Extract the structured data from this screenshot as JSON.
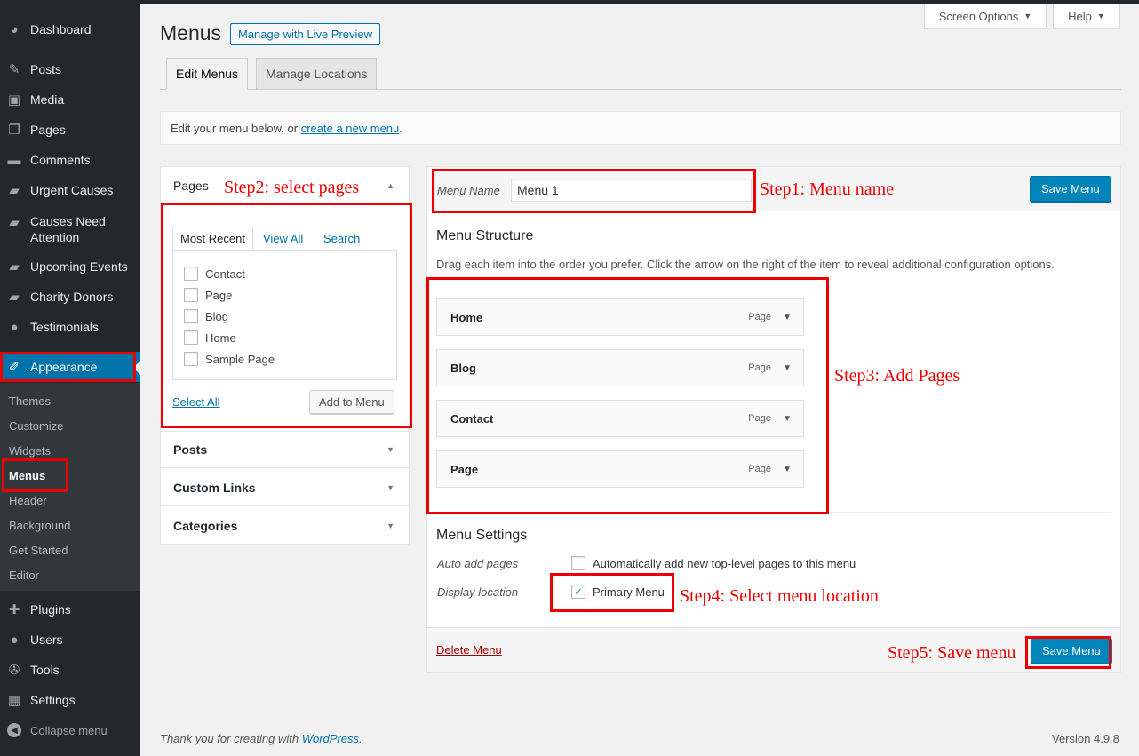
{
  "sidebar": {
    "items": [
      {
        "label": "Dashboard",
        "icon": "dashboard-icon"
      },
      {
        "label": "Posts",
        "icon": "pin-icon"
      },
      {
        "label": "Media",
        "icon": "media-icon"
      },
      {
        "label": "Pages",
        "icon": "pages-icon"
      },
      {
        "label": "Comments",
        "icon": "comment-icon"
      },
      {
        "label": "Urgent Causes",
        "icon": "folder-icon"
      },
      {
        "label": "Causes Need Attention",
        "icon": "folder-icon"
      },
      {
        "label": "Upcoming Events",
        "icon": "folder-icon"
      },
      {
        "label": "Charity Donors",
        "icon": "folder-icon"
      },
      {
        "label": "Testimonials",
        "icon": "user-icon"
      },
      {
        "label": "Appearance",
        "icon": "brush-icon"
      },
      {
        "label": "Plugins",
        "icon": "plugin-icon"
      },
      {
        "label": "Users",
        "icon": "user-icon"
      },
      {
        "label": "Tools",
        "icon": "wrench-icon"
      },
      {
        "label": "Settings",
        "icon": "settings-icon"
      }
    ],
    "submenu": [
      "Themes",
      "Customize",
      "Widgets",
      "Menus",
      "Header",
      "Background",
      "Get Started",
      "Editor"
    ],
    "collapse_label": "Collapse menu"
  },
  "header": {
    "screen_options": "Screen Options",
    "help": "Help",
    "title": "Menus",
    "live_preview": "Manage with Live Preview"
  },
  "tabs": [
    "Edit Menus",
    "Manage Locations"
  ],
  "notice": {
    "prefix": "Edit your menu below, or ",
    "link": "create a new menu",
    "suffix": "."
  },
  "accordion": {
    "pages_title": "Pages",
    "page_tabs": [
      "Most Recent",
      "View All",
      "Search"
    ],
    "pages": [
      "Contact",
      "Page",
      "Blog",
      "Home",
      "Sample Page"
    ],
    "select_all": "Select All",
    "add_to_menu": "Add to Menu",
    "sections": [
      "Posts",
      "Custom Links",
      "Categories"
    ]
  },
  "menu": {
    "name_label": "Menu Name",
    "name_value": "Menu 1",
    "save_label": "Save Menu",
    "structure_title": "Menu Structure",
    "structure_desc": "Drag each item into the order you prefer. Click the arrow on the right of the item to reveal additional configuration options.",
    "items": [
      {
        "title": "Home",
        "type": "Page"
      },
      {
        "title": "Blog",
        "type": "Page"
      },
      {
        "title": "Contact",
        "type": "Page"
      },
      {
        "title": "Page",
        "type": "Page"
      }
    ],
    "settings_title": "Menu Settings",
    "auto_add_label": "Auto add pages",
    "auto_add_text": "Automatically add new top-level pages to this menu",
    "display_location_label": "Display location",
    "primary_menu": "Primary Menu",
    "primary_menu_checked": true,
    "delete_label": "Delete Menu"
  },
  "annotations": {
    "step1": "Step1: Menu name",
    "step2": "Step2: select pages",
    "step3": "Step3: Add Pages",
    "step4": "Step4: Select menu location",
    "step5": "Step5: Save menu"
  },
  "footer": {
    "thanks_prefix": "Thank you for creating with ",
    "thanks_link": "WordPress",
    "thanks_suffix": ".",
    "version": "Version 4.9.8"
  },
  "colors": {
    "sidebar_bg": "#23282d",
    "submenu_bg": "#32373c",
    "accent": "#0073aa",
    "primary_button": "#0085ba",
    "annotation_red": "#ee0000",
    "delete_red": "#aa0000"
  }
}
